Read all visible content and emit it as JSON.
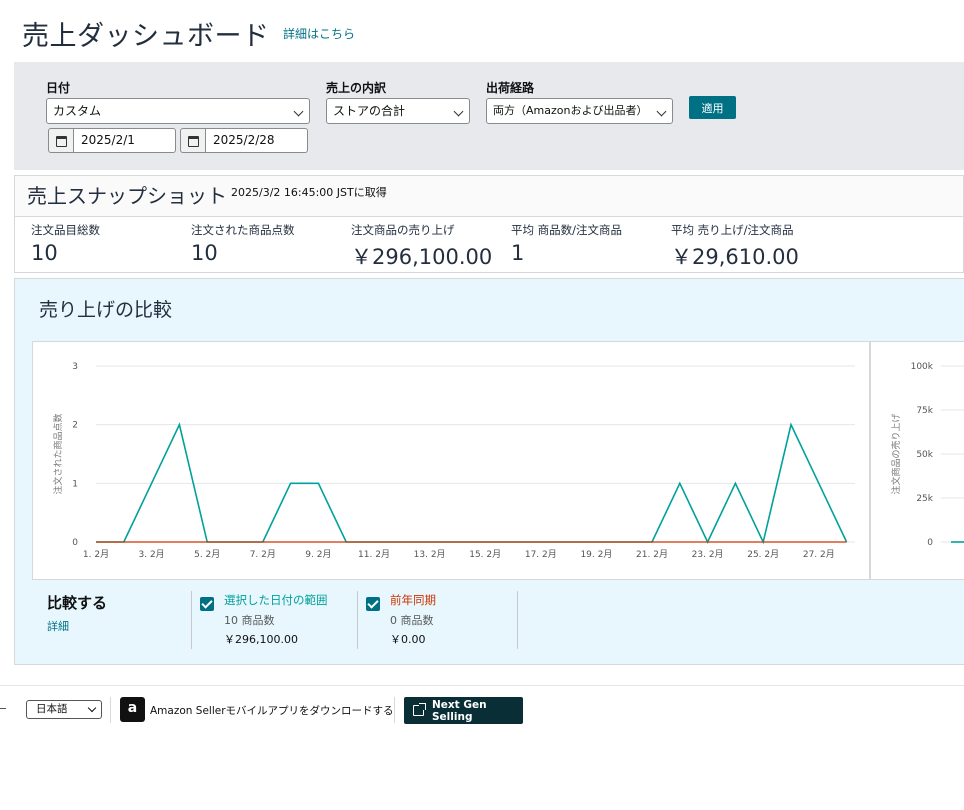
{
  "header": {
    "title": "売上ダッシュボード",
    "details_link": "詳細はこちら"
  },
  "filters": {
    "date": {
      "label": "日付",
      "value": "カスタム",
      "start": "2025/2/1",
      "end": "2025/2/28"
    },
    "breakdown": {
      "label": "売上の内訳",
      "value": "ストアの合計"
    },
    "channel": {
      "label": "出荷経路",
      "value": "両方（Amazonおよび出品者）"
    },
    "apply_label": "適用"
  },
  "snapshot": {
    "title": "売上スナップショット",
    "timestamp": "2025/3/2 16:45:00 JSTに取得",
    "metrics": [
      {
        "label": "注文品目総数",
        "value": "10"
      },
      {
        "label": "注文された商品点数",
        "value": "10"
      },
      {
        "label": "注文商品の売り上げ",
        "value": "￥296,100.00"
      },
      {
        "label": "平均 商品数/注文商品",
        "value": "1"
      },
      {
        "label": "平均 売り上げ/注文商品",
        "value": "￥29,610.00"
      }
    ]
  },
  "comparison": {
    "title": "売り上げの比較",
    "compare_label": "比較する",
    "details_link": "詳細",
    "legend": [
      {
        "name": "選択した日付の範囲",
        "units": "10 商品数",
        "sales": "￥296,100.00",
        "checked": true,
        "color": "#00a19b"
      },
      {
        "name": "前年同期",
        "units": "0 商品数",
        "sales": "￥0.00",
        "checked": true,
        "color": "#cc3300"
      }
    ]
  },
  "chart_data": [
    {
      "type": "line",
      "ylabel": "注文された商品点数",
      "ylim": [
        0,
        3
      ],
      "yticks": [
        "0",
        "1",
        "2",
        "3"
      ],
      "xticks": [
        "1. 2月",
        "3. 2月",
        "5. 2月",
        "7. 2月",
        "9. 2月",
        "11. 2月",
        "13. 2月",
        "15. 2月",
        "17. 2月",
        "19. 2月",
        "21. 2月",
        "23. 2月",
        "25. 2月",
        "27. 2月"
      ],
      "x": [
        "2/1",
        "2/2",
        "2/3",
        "2/4",
        "2/5",
        "2/6",
        "2/7",
        "2/8",
        "2/9",
        "2/10",
        "2/11",
        "2/12",
        "2/13",
        "2/14",
        "2/15",
        "2/16",
        "2/17",
        "2/18",
        "2/19",
        "2/20",
        "2/21",
        "2/22",
        "2/23",
        "2/24",
        "2/25",
        "2/26",
        "2/27",
        "2/28"
      ],
      "series": [
        {
          "values": [
            0,
            0,
            1,
            2,
            0,
            0,
            0,
            1,
            1,
            0,
            0,
            0,
            0,
            0,
            0,
            0,
            0,
            0,
            0,
            0,
            0,
            1,
            0,
            1,
            0,
            2,
            1,
            0
          ],
          "color": "#00a19b"
        },
        {
          "values": [
            0,
            0,
            0,
            0,
            0,
            0,
            0,
            0,
            0,
            0,
            0,
            0,
            0,
            0,
            0,
            0,
            0,
            0,
            0,
            0,
            0,
            0,
            0,
            0,
            0,
            0,
            0,
            0
          ],
          "color": "#cc3300"
        }
      ],
      "grid": true
    },
    {
      "type": "line",
      "ylabel": "注文商品の売り上げ",
      "ylim": [
        0,
        100000
      ],
      "yticks": [
        "0",
        "25k",
        "50k",
        "75k",
        "100k"
      ],
      "grid": true
    }
  ],
  "footer": {
    "language": "日本語",
    "app_icon_letter": "a",
    "app_text": "Amazon Sellerモバイルアプリをダウンロードする",
    "next_gen_label": "Next Gen Selling"
  }
}
